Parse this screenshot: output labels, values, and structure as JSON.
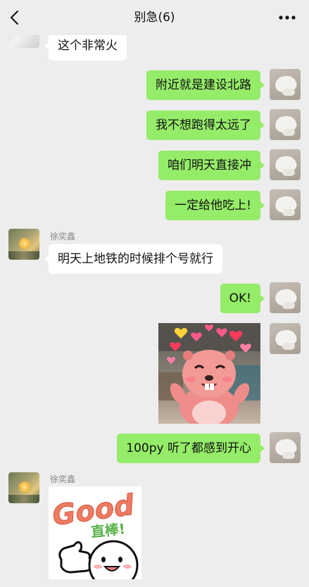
{
  "header": {
    "title": "别急(6)",
    "back_icon": "chevron-left-icon",
    "more_icon": "more-dots-icon"
  },
  "messages": [
    {
      "side": "left",
      "text": "这个非常火"
    },
    {
      "side": "right",
      "text": "附近就是建设北路"
    },
    {
      "side": "right",
      "text": "我不想跑得太远了"
    },
    {
      "side": "right",
      "text": "咱们明天直接冲"
    },
    {
      "side": "right",
      "text": "一定给他吃上!"
    },
    {
      "side": "left",
      "sender": "徐奕鑫",
      "text": "明天上地铁的时候排个号就行"
    },
    {
      "side": "right",
      "text": "OK!"
    },
    {
      "side": "right",
      "type": "sticker",
      "sticker": "pink-beaver-sticker"
    },
    {
      "side": "right",
      "text": "100py 听了都感到开心"
    },
    {
      "side": "left",
      "sender": "徐奕鑫",
      "type": "sticker",
      "sticker": "good-sticker",
      "sticker_text": [
        "Good",
        "直棒!"
      ]
    }
  ],
  "colors": {
    "background": "#ededed",
    "self_bubble": "#95ec69",
    "other_bubble": "#ffffff",
    "sender_name": "#8a8a8a",
    "good_text": "#ef7a62",
    "good_sub": "#5bb34a"
  }
}
